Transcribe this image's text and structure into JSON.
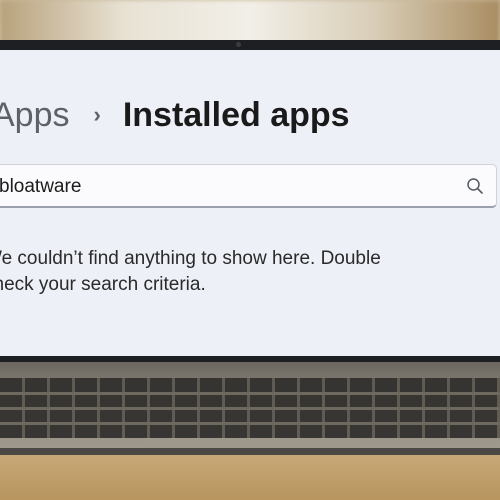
{
  "breadcrumb": {
    "parent": "Apps",
    "separator": "›",
    "current": "Installed apps"
  },
  "search": {
    "value": "bloatware",
    "icon": "search-icon"
  },
  "empty_state": {
    "message": "We couldn’t find anything to show here. Double check your search criteria."
  },
  "colors": {
    "screen_background": "#eef0f8",
    "bezel": "#1e1f22",
    "title_text": "#1a1a1a",
    "secondary_text": "#5e6168"
  }
}
